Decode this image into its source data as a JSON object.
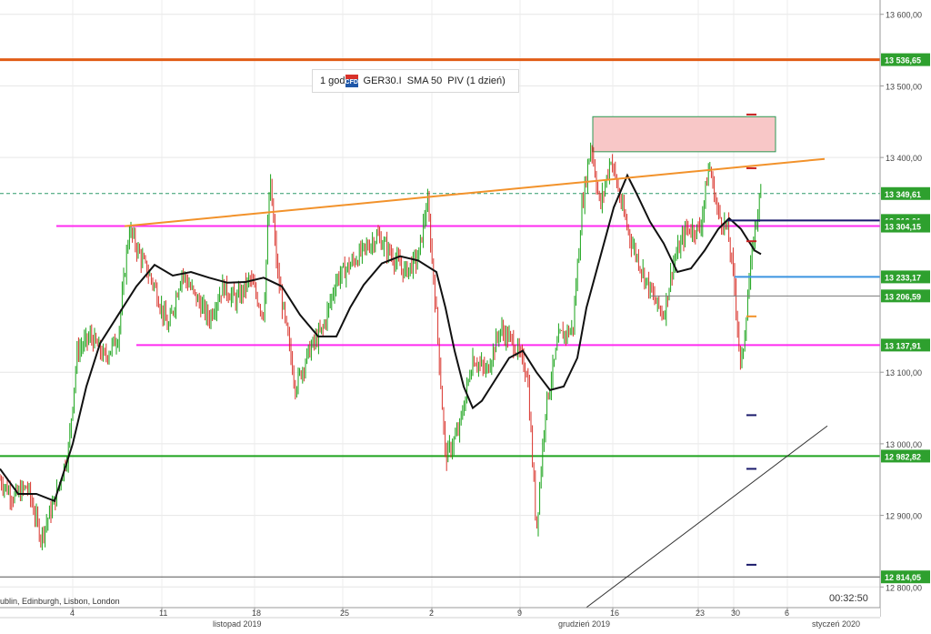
{
  "legend": {
    "interval": "1 god",
    "icon": "cfd-icon",
    "symbol": "GER30.I",
    "indicator": "SMA 50",
    "pivots": "PIV (1 dzień)"
  },
  "timezone_label": "ublin, Edinburgh, Lisbon, London",
  "timer": "00:32:50",
  "colors": {
    "candle_up": "#19a319",
    "candle_down": "#d9322a",
    "sma": "#111111",
    "magenta": "#ff2bf0",
    "orange_line": "#f2922b",
    "resistance": "#e15c16",
    "support_green": "#1fa31f",
    "zone_fill": "#f8c7c7",
    "zone_border": "#2b9a54",
    "pivot_navy": "#1a1a6b",
    "pivot_blue": "#3c94e0",
    "pivot_red": "#c82020",
    "price_tag": "#2ea02e"
  },
  "chart_data": {
    "type": "line",
    "title": "",
    "ylim": [
      12794,
      13620
    ],
    "y_ticks": [
      "12 800,00",
      "12 900,00",
      "13 000,00",
      "13 100,00",
      "13 400,00",
      "13 500,00",
      "13 600,00"
    ],
    "x_ticks": [
      "4",
      "11",
      "18",
      "25",
      "2",
      "9",
      "16",
      "23",
      "30",
      "6"
    ],
    "month_labels": [
      "listopad 2019",
      "grudzień 2019",
      "styczeń 2020"
    ],
    "price_labels": [
      "13 536,65",
      "13 349,61",
      "13 312,01",
      "13 304,15",
      "13 233,17",
      "13 206,59",
      "13 137,91",
      "12 982,82",
      "12 814,05"
    ],
    "horizontal_levels": [
      {
        "value": 13536.65,
        "name": "resistance"
      },
      {
        "value": 13304.15,
        "name": "upper-magenta"
      },
      {
        "value": 13137.91,
        "name": "lower-magenta"
      },
      {
        "value": 12982.82,
        "name": "green-support"
      },
      {
        "value": 12814.05,
        "name": "bottom-level"
      },
      {
        "value": 13349.61,
        "name": "current-price"
      }
    ],
    "pivot_levels": [
      {
        "value": 13312.01,
        "color": "navy"
      },
      {
        "value": 13233.17,
        "color": "blue"
      },
      {
        "value": 13206.59,
        "color": "gray"
      }
    ],
    "zone": {
      "x_start": 0.637,
      "x_end": 0.838,
      "y_low": 13408,
      "y_high": 13457
    },
    "trendlines": [
      {
        "name": "orange-trendline",
        "x0": 0.137,
        "y0": 13304,
        "x1": 0.907,
        "y1": 13398
      },
      {
        "name": "gray-trendline",
        "x0": 0.63,
        "y0": 12757,
        "x1": 0.91,
        "y1": 13025
      }
    ],
    "price_path": [
      [
        0.0,
        12950
      ],
      [
        0.015,
        12925
      ],
      [
        0.03,
        12940
      ],
      [
        0.045,
        12870
      ],
      [
        0.06,
        12920
      ],
      [
        0.075,
        12990
      ],
      [
        0.085,
        13130
      ],
      [
        0.1,
        13150
      ],
      [
        0.115,
        13120
      ],
      [
        0.13,
        13150
      ],
      [
        0.142,
        13300
      ],
      [
        0.155,
        13260
      ],
      [
        0.17,
        13220
      ],
      [
        0.185,
        13160
      ],
      [
        0.2,
        13240
      ],
      [
        0.215,
        13205
      ],
      [
        0.23,
        13175
      ],
      [
        0.245,
        13220
      ],
      [
        0.26,
        13200
      ],
      [
        0.275,
        13230
      ],
      [
        0.29,
        13180
      ],
      [
        0.297,
        13370
      ],
      [
        0.305,
        13240
      ],
      [
        0.315,
        13160
      ],
      [
        0.325,
        13080
      ],
      [
        0.34,
        13130
      ],
      [
        0.355,
        13160
      ],
      [
        0.37,
        13230
      ],
      [
        0.385,
        13250
      ],
      [
        0.4,
        13270
      ],
      [
        0.415,
        13290
      ],
      [
        0.43,
        13265
      ],
      [
        0.445,
        13240
      ],
      [
        0.46,
        13260
      ],
      [
        0.47,
        13340
      ],
      [
        0.48,
        13180
      ],
      [
        0.49,
        12980
      ],
      [
        0.505,
        13020
      ],
      [
        0.52,
        13120
      ],
      [
        0.535,
        13100
      ],
      [
        0.55,
        13160
      ],
      [
        0.565,
        13140
      ],
      [
        0.58,
        13100
      ],
      [
        0.59,
        12880
      ],
      [
        0.6,
        13050
      ],
      [
        0.615,
        13150
      ],
      [
        0.63,
        13160
      ],
      [
        0.64,
        13330
      ],
      [
        0.65,
        13420
      ],
      [
        0.66,
        13330
      ],
      [
        0.672,
        13400
      ],
      [
        0.684,
        13330
      ],
      [
        0.695,
        13280
      ],
      [
        0.707,
        13240
      ],
      [
        0.72,
        13200
      ],
      [
        0.73,
        13180
      ],
      [
        0.74,
        13250
      ],
      [
        0.755,
        13300
      ],
      [
        0.77,
        13300
      ],
      [
        0.78,
        13390
      ],
      [
        0.79,
        13320
      ],
      [
        0.8,
        13300
      ],
      [
        0.808,
        13220
      ],
      [
        0.815,
        13100
      ],
      [
        0.822,
        13200
      ],
      [
        0.83,
        13300
      ],
      [
        0.837,
        13350
      ]
    ],
    "sma_path": [
      [
        0.0,
        12965
      ],
      [
        0.02,
        12930
      ],
      [
        0.04,
        12930
      ],
      [
        0.06,
        12920
      ],
      [
        0.08,
        13000
      ],
      [
        0.095,
        13080
      ],
      [
        0.11,
        13140
      ],
      [
        0.13,
        13180
      ],
      [
        0.15,
        13220
      ],
      [
        0.17,
        13250
      ],
      [
        0.19,
        13235
      ],
      [
        0.21,
        13240
      ],
      [
        0.23,
        13232
      ],
      [
        0.25,
        13225
      ],
      [
        0.27,
        13226
      ],
      [
        0.29,
        13232
      ],
      [
        0.31,
        13220
      ],
      [
        0.33,
        13180
      ],
      [
        0.35,
        13150
      ],
      [
        0.37,
        13150
      ],
      [
        0.385,
        13190
      ],
      [
        0.4,
        13222
      ],
      [
        0.42,
        13252
      ],
      [
        0.44,
        13262
      ],
      [
        0.46,
        13256
      ],
      [
        0.48,
        13240
      ],
      [
        0.49,
        13190
      ],
      [
        0.5,
        13130
      ],
      [
        0.51,
        13080
      ],
      [
        0.52,
        13050
      ],
      [
        0.53,
        13060
      ],
      [
        0.545,
        13090
      ],
      [
        0.56,
        13120
      ],
      [
        0.575,
        13130
      ],
      [
        0.59,
        13100
      ],
      [
        0.605,
        13075
      ],
      [
        0.62,
        13080
      ],
      [
        0.635,
        13120
      ],
      [
        0.645,
        13190
      ],
      [
        0.66,
        13260
      ],
      [
        0.675,
        13330
      ],
      [
        0.69,
        13375
      ],
      [
        0.7,
        13350
      ],
      [
        0.715,
        13310
      ],
      [
        0.73,
        13280
      ],
      [
        0.745,
        13240
      ],
      [
        0.76,
        13245
      ],
      [
        0.775,
        13270
      ],
      [
        0.79,
        13300
      ],
      [
        0.802,
        13315
      ],
      [
        0.815,
        13300
      ],
      [
        0.83,
        13270
      ],
      [
        0.837,
        13265
      ]
    ]
  }
}
